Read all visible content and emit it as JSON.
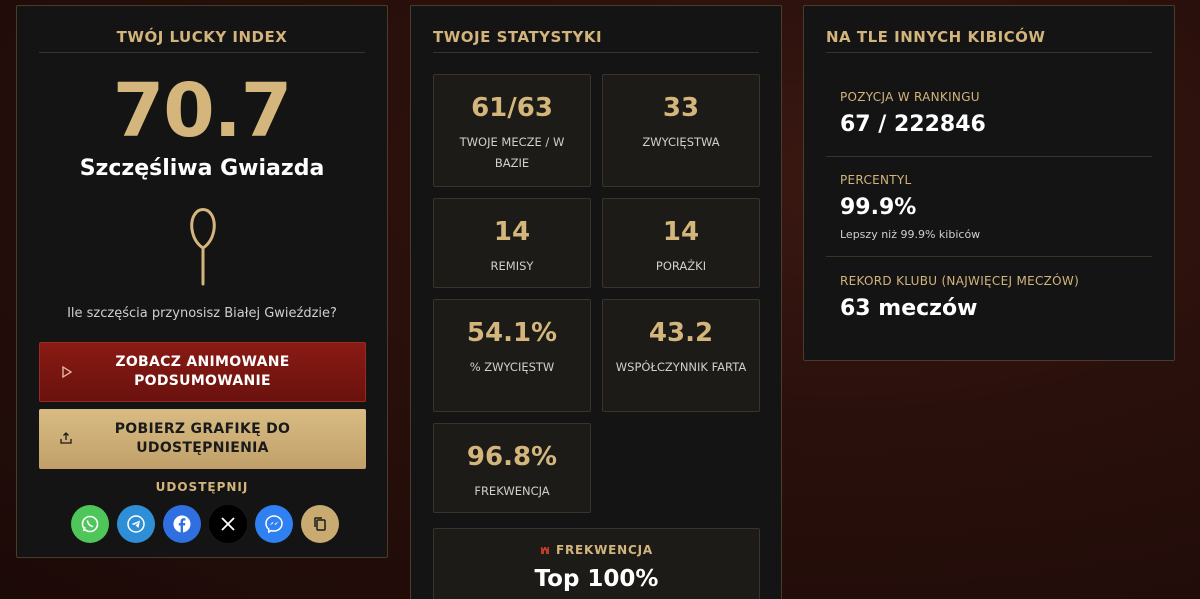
{
  "lucky": {
    "title": "TWÓJ LUCKY INDEX",
    "score": "70.7",
    "rank_title": "Szczęśliwa Gwiazda",
    "icon": "lucky-charm-icon",
    "question": "Ile szczęścia przynosisz Białej Gwieździe?",
    "btn_animated": "ZOBACZ ANIMOWANE PODSUMOWANIE",
    "btn_download": "POBIERZ GRAFIKĘ DO UDOSTĘPNIENIA",
    "share_label": "UDOSTĘPNIJ",
    "share_buttons": [
      {
        "name": "whatsapp",
        "color": "#4fc65a"
      },
      {
        "name": "telegram",
        "color": "#2f8fd6"
      },
      {
        "name": "facebook",
        "color": "#2f6fe0"
      },
      {
        "name": "x",
        "color": "#000000"
      },
      {
        "name": "messenger",
        "color": "#2f80f0"
      },
      {
        "name": "copy",
        "color": "#c9ab72"
      }
    ]
  },
  "stats": {
    "title": "TWOJE STATYSTYKI",
    "tiles": [
      {
        "value": "61/63",
        "label": "TWOJE MECZE / W BAZIE"
      },
      {
        "value": "33",
        "label": "ZWYCIĘSTWA"
      },
      {
        "value": "14",
        "label": "REMISY"
      },
      {
        "value": "14",
        "label": "PORAŻKI"
      },
      {
        "value": "54.1%",
        "label": "% ZWYCIĘSTW"
      },
      {
        "value": "43.2",
        "label": "WSPÓŁCZYNNIK FARTA"
      },
      {
        "value": "96.8%",
        "label": "FREKWENCJA"
      }
    ],
    "attendance": {
      "label": "FREKWENCJA",
      "value": "Top 100%"
    }
  },
  "ranking": {
    "title": "NA TLE INNYCH KIBICÓW",
    "position_label": "POZYCJA W RANKINGU",
    "position_value": "67 / 222846",
    "percentile_label": "PERCENTYL",
    "percentile_value": "99.9%",
    "percentile_sub": "Lepszy niż 99.9% kibiców",
    "record_label": "REKORD KLUBU (NAJWIĘCEJ MECZÓW)",
    "record_value": "63 meczów"
  },
  "colors": {
    "gold": "#d4b67c",
    "panel": "#141414",
    "red": "#8a1a14"
  }
}
